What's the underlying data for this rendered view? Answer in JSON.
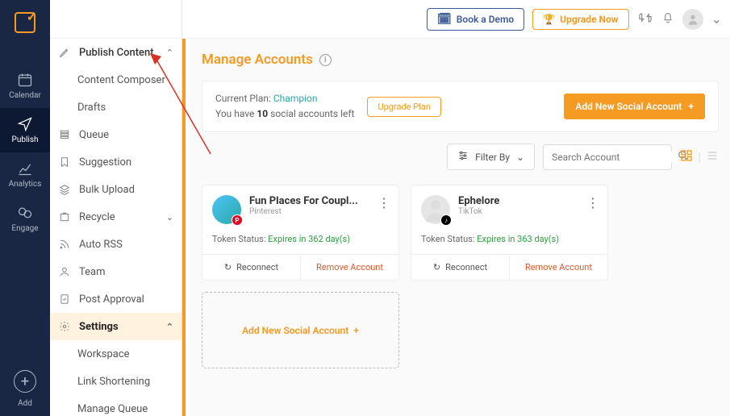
{
  "rail": {
    "calendar": "Calendar",
    "publish": "Publish",
    "analytics": "Analytics",
    "engage": "Engage",
    "add": "Add"
  },
  "sidebar": {
    "publish_content": "Publish Content",
    "content_composer": "Content Composer",
    "drafts": "Drafts",
    "queue": "Queue",
    "suggestion": "Suggestion",
    "bulk_upload": "Bulk Upload",
    "recycle": "Recycle",
    "auto_rss": "Auto RSS",
    "team": "Team",
    "post_approval": "Post Approval",
    "settings": "Settings",
    "workspace": "Workspace",
    "link_shortening": "Link Shortening",
    "manage_queue": "Manage Queue"
  },
  "top": {
    "book_demo": "Book a Demo",
    "upgrade_now": "Upgrade Now"
  },
  "page": {
    "title": "Manage Accounts",
    "plan_label": "Current Plan: ",
    "plan_name": "Champion",
    "plan_sub_prefix": "You have ",
    "plan_count": "10",
    "plan_sub_suffix": " social accounts left",
    "upgrade_plan": "Upgrade Plan",
    "add_social": "Add New Social Account",
    "filter_by": "Filter By",
    "search_placeholder": "Search Account",
    "add_social_card": "Add New Social Account"
  },
  "cards": [
    {
      "name": "Fun Places For Coupl...",
      "network": "Pinterest",
      "token_label": "Token Status: ",
      "token_status": "Expires in 362 day(s)",
      "reconnect": "Reconnect",
      "remove": "Remove Account",
      "badge": "P"
    },
    {
      "name": "Ephelore",
      "network": "TikTok",
      "token_label": "Token Status: ",
      "token_status": "Expires in 363 day(s)",
      "reconnect": "Reconnect",
      "remove": "Remove Account",
      "badge": "♪"
    }
  ]
}
